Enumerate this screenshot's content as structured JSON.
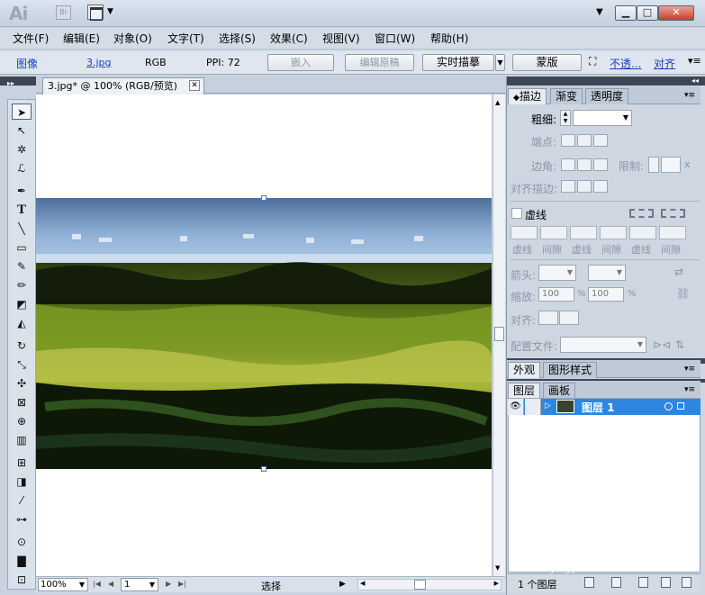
{
  "app": {
    "logo": "Ai",
    "bridge_label": "Br",
    "window_controls": {
      "minimize": "▁",
      "maximize": "□",
      "close": "✕"
    }
  },
  "menubar": {
    "items": [
      "文件(F)",
      "编辑(E)",
      "对象(O)",
      "文字(T)",
      "选择(S)",
      "效果(C)",
      "视图(V)",
      "窗口(W)",
      "帮助(H)"
    ]
  },
  "control_bar": {
    "type_label": "图像",
    "filename": "3.jpg",
    "color_mode": "RGB",
    "ppi": "PPI: 72",
    "embed": "嵌入",
    "edit_original": "编辑原稿",
    "live_trace": "实时描摹",
    "mask": "蒙版",
    "opacity_link": "不透...",
    "align_link": "对齐"
  },
  "document": {
    "tab_title": "3.jpg* @ 100% (RGB/预览)",
    "tab_close": "✕"
  },
  "status_bar": {
    "zoom": "100%",
    "page": "1",
    "label": "选择"
  },
  "stroke_panel": {
    "tabs": [
      "描边",
      "渐变",
      "透明度"
    ],
    "weight_label": "粗细:",
    "cap_label": "端点:",
    "corner_label": "边角:",
    "limit_label": "限制:",
    "limit_value": "x",
    "align_label": "对齐描边:",
    "dashed_label": "虚线",
    "dash_labels": [
      "虚线",
      "间隙",
      "虚线",
      "间隙",
      "虚线",
      "间隙"
    ],
    "arrow_label": "箭头:",
    "scale_label": "缩放:",
    "scale_start": "100",
    "scale_end": "100",
    "percent": "%",
    "align_arrow_label": "对齐:",
    "profile_label": "配置文件:"
  },
  "appearance_panel": {
    "tabs": [
      "外观",
      "图形样式"
    ]
  },
  "layers_panel": {
    "tabs": [
      "图层",
      "画板"
    ],
    "layer_name": "图层 1",
    "footer_count": "1 个图层"
  },
  "watermark": {
    "main": "Baidu经验",
    "sub": "jingyan.baidu.com"
  },
  "colors": {
    "selection_blue": "#2e86e0",
    "handle_blue": "#4c79d8",
    "panel_dark": "#3d4655"
  }
}
